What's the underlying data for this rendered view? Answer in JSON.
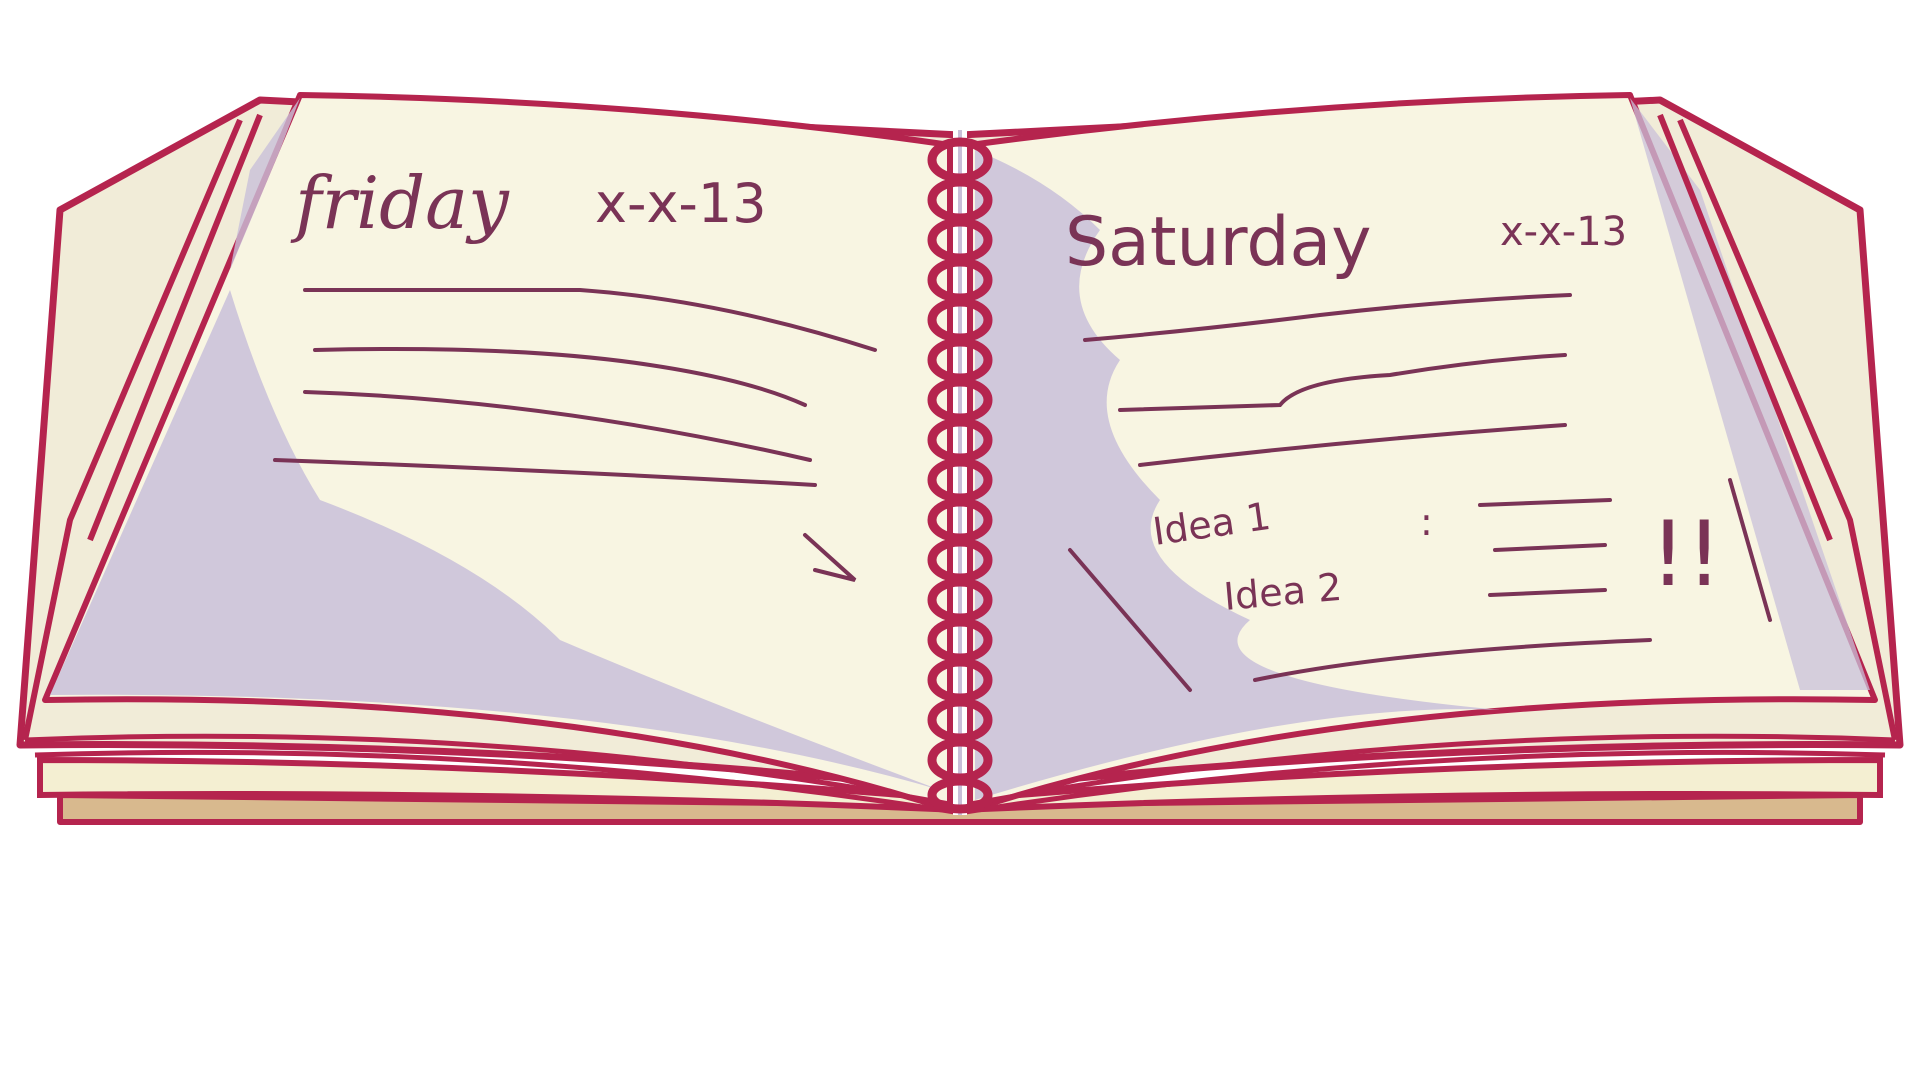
{
  "colors": {
    "cover": "#b5244e",
    "page": "#f8f5e2",
    "shadow": "#c9c0d9",
    "ink": "#7a3356",
    "edge_tan": "#d8b98e"
  },
  "left_page": {
    "day": "friday",
    "date": "x-x-13"
  },
  "right_page": {
    "day": "Saturday",
    "date": "x-x-13",
    "idea_1": "Idea 1",
    "separator": ":",
    "idea_2": "Idea 2",
    "exclaim": "!!"
  }
}
